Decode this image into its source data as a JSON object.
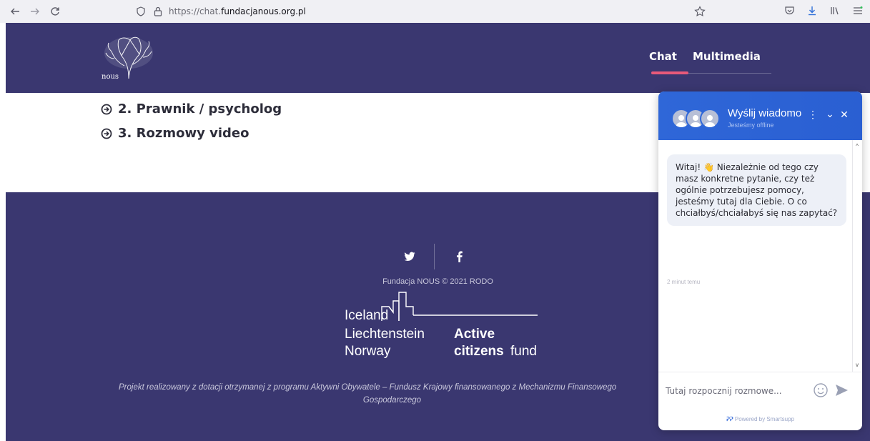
{
  "browser": {
    "url_prefix": "https://chat.",
    "url_domain": "fundacjanous.org.pl"
  },
  "site": {
    "logo_text": "nous",
    "menu": [
      {
        "label": "Chat",
        "active": true
      },
      {
        "label": "Multimedia",
        "active": false
      }
    ],
    "accent_color": "#e85a7a",
    "header_color": "#3a3770"
  },
  "content": {
    "items": [
      {
        "label": "2. Prawnik / psycholog"
      },
      {
        "label": "3. Rozmowy video"
      }
    ]
  },
  "footer": {
    "copyright": "Fundacja NOUS © 2021 RODO",
    "acf": {
      "iceland": "Iceland",
      "liechtenstein": "Liechtenstein",
      "norway": "Norway",
      "active": "Active",
      "citizens": "citizens",
      "fund": "fund"
    },
    "project_line1": "Projekt realizowany z dotacji otrzymanej z programu Aktywni Obywatele – Fundusz Krajowy finansowanego z Mechanizmu Finansowego",
    "project_line2": "Gospodarczego"
  },
  "chat": {
    "title": "Wyślij wiadomo",
    "status": "Jesteśmy offline",
    "message": "Witaj! 👋 Niezależnie od tego czy masz konkretne pytanie, czy też ogólnie potrzebujesz pomocy, jesteśmy tutaj dla Ciebie. O co chciałbyś/chciałabyś się nas zapytać?",
    "message_time": "2 minut temu",
    "input_placeholder": "Tutaj rozpocznij rozmowe...",
    "powered_prefix": "Powered by Smartsupp",
    "brand_color": "#2f67d8"
  }
}
